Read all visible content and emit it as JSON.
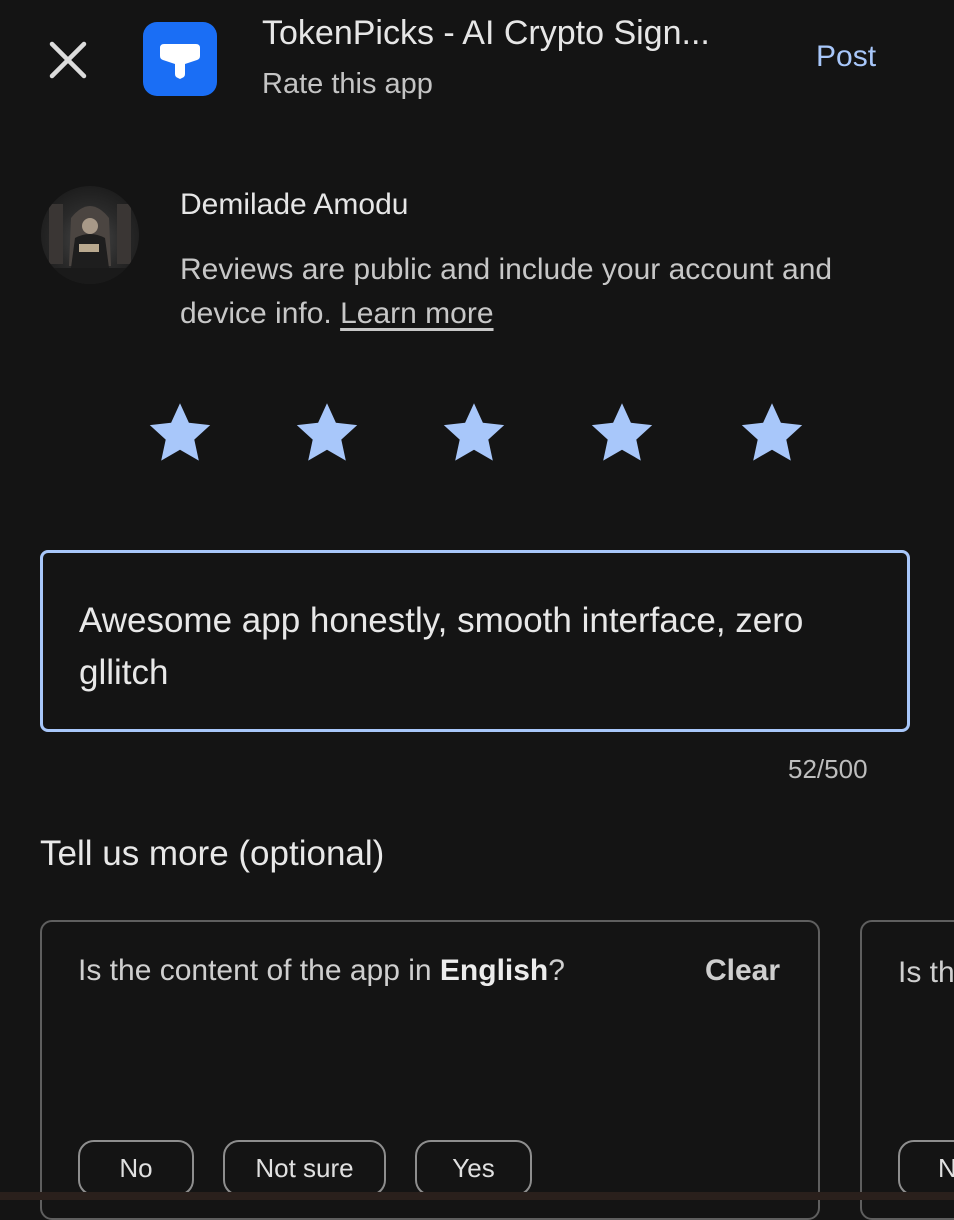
{
  "header": {
    "app_title": "TokenPicks - AI Crypto Sign...",
    "subtitle": "Rate this app",
    "post_label": "Post"
  },
  "user": {
    "name": "Demilade Amodu",
    "disclaimer": "Reviews are public and include your account and device info.",
    "learn_more": "Learn more"
  },
  "rating": {
    "value": 5,
    "max": 5,
    "star_color": "#a8c7fa"
  },
  "review": {
    "text": "Awesome app honestly, smooth interface, zero gllitch",
    "char_count": "52/500"
  },
  "more": {
    "title": "Tell us more (optional)",
    "cards": [
      {
        "question_prefix": "Is the content of the app in ",
        "question_bold": "English",
        "question_suffix": "?",
        "clear_label": "Clear",
        "options": [
          "No",
          "Not sure",
          "Yes"
        ]
      },
      {
        "question_partial": "Is th",
        "option_partial": "N"
      }
    ]
  },
  "colors": {
    "background": "#141414",
    "accent": "#a8c7fa",
    "app_icon": "#1a6ef5"
  }
}
